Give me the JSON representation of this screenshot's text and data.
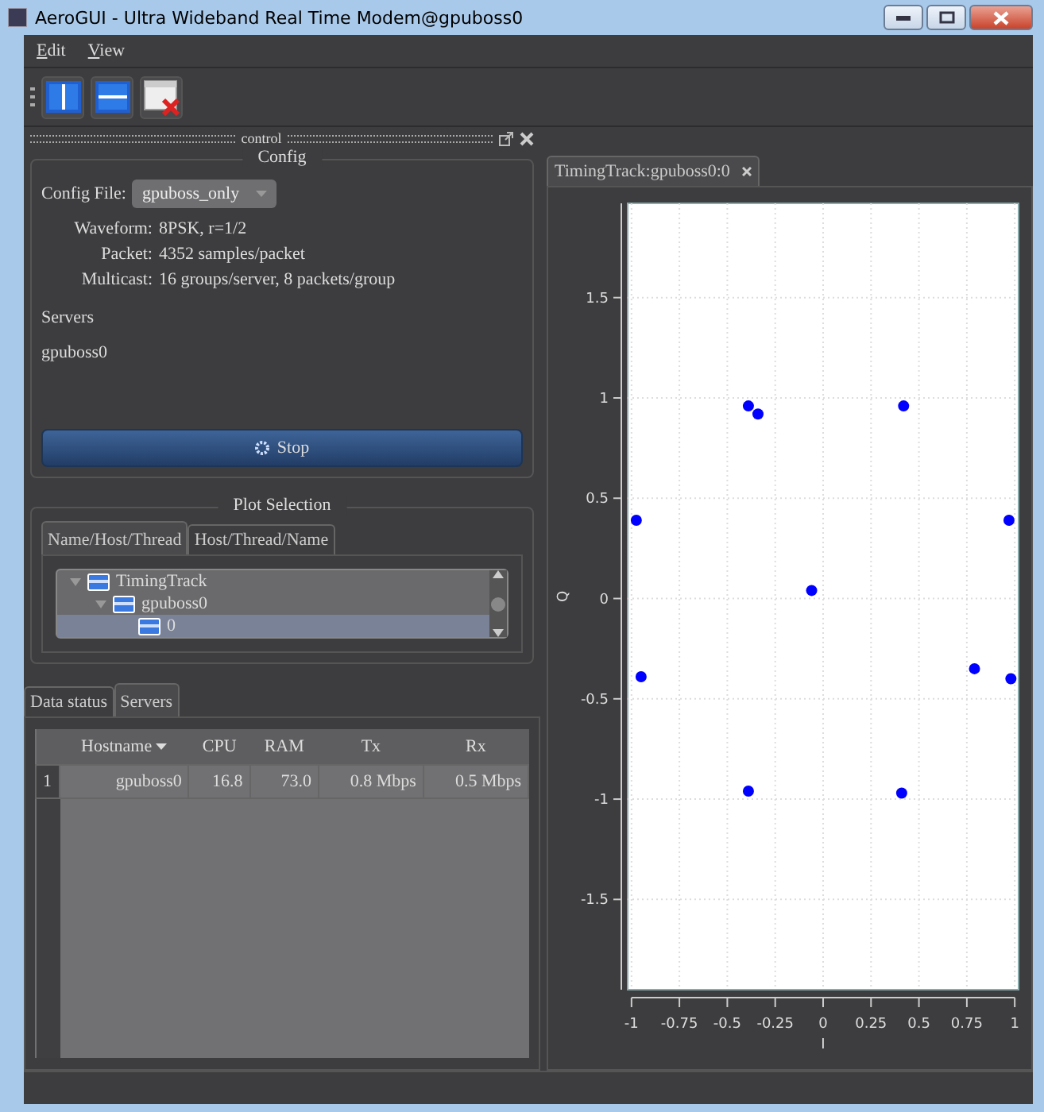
{
  "window": {
    "title": "AeroGUI - Ultra Wideband Real Time Modem@gpuboss0"
  },
  "menu": [
    {
      "label": "Edit"
    },
    {
      "label": "View"
    }
  ],
  "control_dock": {
    "title": "control"
  },
  "config": {
    "title": "Config",
    "config_file": {
      "label": "Config File:",
      "value": "gpuboss_only"
    },
    "fields": [
      {
        "label": "Waveform:",
        "value": "8PSK, r=1/2"
      },
      {
        "label": "Packet:",
        "value": "4352 samples/packet"
      },
      {
        "label": "Multicast:",
        "value": "16 groups/server, 8 packets/group"
      }
    ],
    "servers_label": "Servers",
    "servers": [
      "gpuboss0"
    ],
    "stop_button": "Stop"
  },
  "plot_selection": {
    "title": "Plot Selection",
    "tabs": [
      {
        "label": "Name/Host/Thread",
        "selected": true
      },
      {
        "label": "Host/Thread/Name",
        "selected": false
      }
    ],
    "tree": [
      {
        "label": "TimingTrack",
        "expanded": true,
        "selected": false,
        "children": [
          {
            "label": "gpuboss0",
            "expanded": true,
            "selected": false,
            "children": [
              {
                "label": "0",
                "selected": true
              }
            ]
          }
        ]
      }
    ]
  },
  "bottom_tabs": [
    {
      "label": "Data status",
      "selected": false
    },
    {
      "label": "Servers",
      "selected": true
    }
  ],
  "table": {
    "columns": [
      {
        "label": "Hostname",
        "sorted": true
      },
      {
        "label": "CPU",
        "sorted": false
      },
      {
        "label": "RAM",
        "sorted": false
      },
      {
        "label": "Tx",
        "sorted": false
      },
      {
        "label": "Rx",
        "sorted": false
      }
    ],
    "rows": [
      {
        "index": "1",
        "cells": [
          "gpuboss0",
          "16.8",
          "73.0",
          "0.8 Mbps",
          "0.5 Mbps"
        ]
      }
    ]
  },
  "plot_tab": {
    "label": "TimingTrack:gpuboss0:0"
  },
  "chart_data": {
    "type": "scatter",
    "grid": true,
    "xlabel": "I",
    "ylabel": "Q",
    "xlim": [
      -1.02,
      1.02
    ],
    "ylim": [
      -1.95,
      1.97
    ],
    "xticks": [
      -1,
      -0.75,
      -0.5,
      -0.25,
      0,
      0.25,
      0.5,
      0.75,
      1
    ],
    "yticks": [
      -1.5,
      -1,
      -0.5,
      0,
      0.5,
      1,
      1.5
    ],
    "series": [
      {
        "color": "#0000ff",
        "x": [
          -0.975,
          -0.39,
          -0.34,
          0.42,
          0.97,
          -0.06,
          -0.95,
          0.79,
          0.98,
          -0.39,
          0.41
        ],
        "values": [
          0.39,
          0.96,
          0.92,
          0.96,
          0.39,
          0.04,
          -0.39,
          -0.35,
          -0.4,
          -0.96,
          -0.97
        ]
      }
    ]
  }
}
